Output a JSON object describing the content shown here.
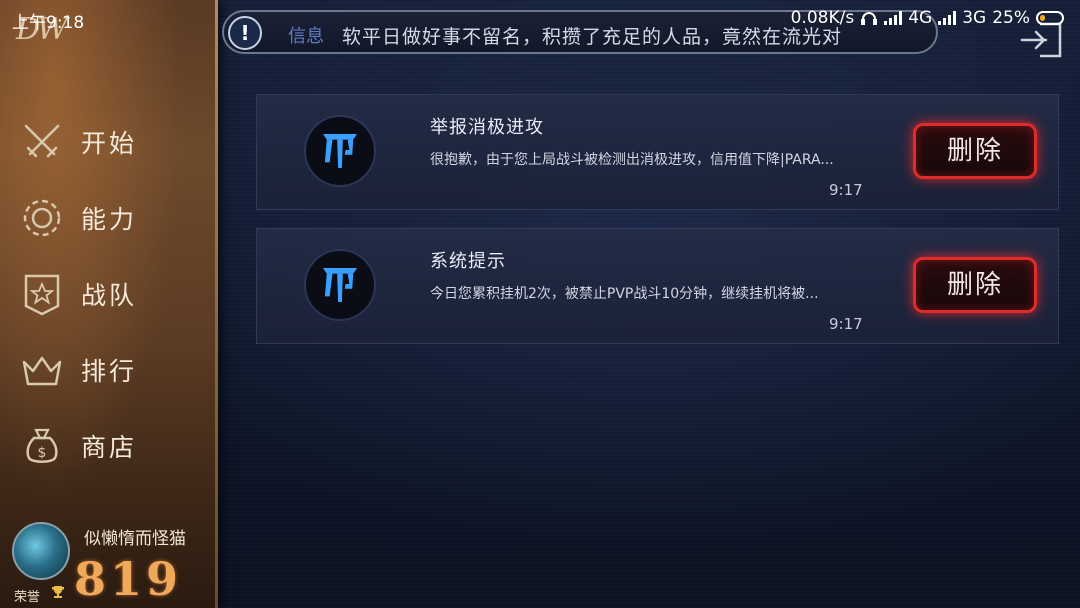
{
  "status_bar": {
    "time": "上午9:18",
    "speed": "0.08K/s",
    "net1": "4G",
    "net2": "3G",
    "battery": "25%",
    "battery_level": 0.25
  },
  "sidebar": {
    "logo": "DW",
    "items": [
      {
        "label": "开始",
        "icon": "crossed-swords-icon"
      },
      {
        "label": "能力",
        "icon": "gear-icon"
      },
      {
        "label": "战队",
        "icon": "shield-star-icon"
      },
      {
        "label": "排行",
        "icon": "crown-icon"
      },
      {
        "label": "商店",
        "icon": "money-bag-icon"
      }
    ],
    "profile": {
      "username": "似懒惰而怪猫",
      "honor_label": "荣誉",
      "score": "819"
    }
  },
  "notice": {
    "icon": "!",
    "tab_label": "信息",
    "text": "软平日做好事不留名，积攒了充足的人品，竟然在流光对"
  },
  "messages": [
    {
      "title": "举报消极进攻",
      "body": "很抱歉，由于您上局战斗被检测出消极进攻，信用值下降|PARA...",
      "time": "9:17",
      "delete_label": "删除"
    },
    {
      "title": "系统提示",
      "body": "今日您累积挂机2次，被禁止PVP战斗10分钟，继续挂机将被...",
      "time": "9:17",
      "delete_label": "删除"
    }
  ],
  "colors": {
    "accent_red": "#e02b2b",
    "score_orange": "#f0a85a",
    "emblem_blue": "#3aa0ff"
  }
}
